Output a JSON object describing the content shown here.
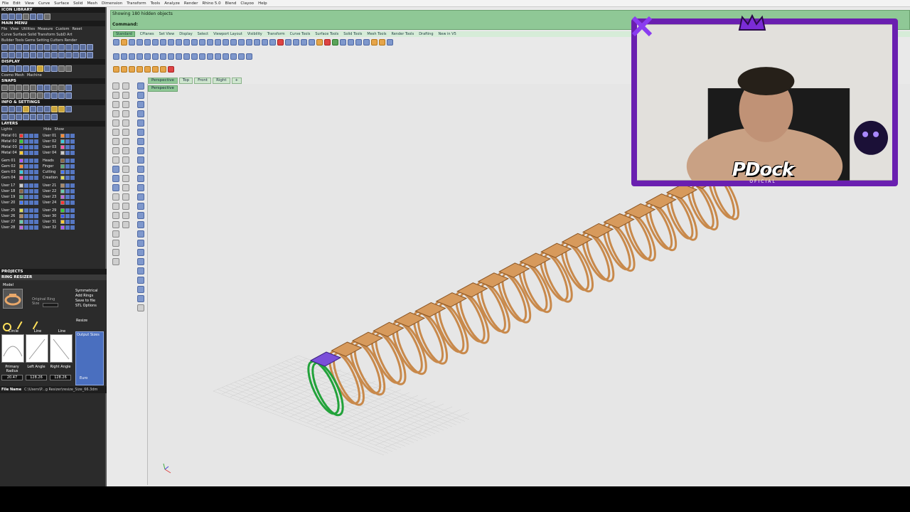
{
  "menu": [
    "File",
    "Edit",
    "View",
    "Curve",
    "Surface",
    "Solid",
    "Mesh",
    "Dimension",
    "Transform",
    "Tools",
    "Analyze",
    "Render",
    "Rhino 5.0",
    "Blend",
    "Clayoo",
    "Help"
  ],
  "left_panel": {
    "section_icon_library": "ICON LIBRARY",
    "section_main_menu": "MAIN MENU",
    "main_menu_items": [
      "File",
      "View",
      "Utilities",
      "Measure",
      "Custom",
      "Reset"
    ],
    "main_menu_sub1": "Curve  Surface  Solid  Transform  SubD  Art",
    "main_menu_sub2": "Builder  Tools  Gems  Setting  Cutters  Render",
    "section_display": "DISPLAY",
    "display_modes": [
      "Cosmo Mesh",
      "Machine"
    ],
    "section_snaps": "SNAPS",
    "section_info": "INFO & SETTINGS",
    "section_layers": "LAYERS",
    "layers_header": [
      "Lights",
      "Hide",
      "Show"
    ],
    "layers_left": [
      "Metal 01",
      "Metal 02",
      "Metal 03",
      "Metal 04",
      "Gem 01",
      "Gem 02",
      "Gem 03",
      "Gem 04",
      "User 17",
      "User 18",
      "User 19",
      "User 20",
      "User 25",
      "User 26",
      "User 27",
      "User 28"
    ],
    "layers_right": [
      "User 01",
      "User 02",
      "User 03",
      "User 04",
      "Heads",
      "Finger",
      "Cutting",
      "Creation",
      "User 21",
      "User 22",
      "User 23",
      "User 24",
      "User 29",
      "User 30",
      "User 31",
      "User 32"
    ],
    "section_projects": "PROJECTS",
    "section_ring_resizer": "RING RESIZER",
    "resizer_model": "Model",
    "resizer_original": "Original Ring Size",
    "resizer_options": [
      "Symmetrical",
      "Add Rings",
      "Save to file",
      "STL Options"
    ],
    "resizer_resize": "Resize",
    "resizer_shapes": [
      "Circle",
      "Line",
      "Line"
    ],
    "resizer_output": "Output Sizes",
    "resizer_primary_label": "Primary Radius",
    "resizer_left_label": "Left Angle",
    "resizer_right_label": "Right Angle",
    "resizer_primary_val": "20.47",
    "resizer_left_val": "128.26",
    "resizer_right_val": "128.26",
    "resizer_unit": "Euro",
    "file_name_label": "File Name",
    "file_name_value": "C:\\Users\\P...g Resizer\\resize_Size_66.3dm"
  },
  "command": {
    "line1": "Showing 180 hidden objects",
    "line2": "Command:"
  },
  "tabs": [
    "Standard",
    "CPlanes",
    "Set View",
    "Display",
    "Select",
    "Viewport Layout",
    "Visibility",
    "Transform",
    "Curve Tools",
    "Surface Tools",
    "Solid Tools",
    "Mesh Tools",
    "Render Tools",
    "Drafting",
    "New in V5"
  ],
  "viewport": {
    "tabs": [
      "Perspective",
      "Top",
      "Front",
      "Right"
    ],
    "add_tab": "+",
    "label": "Perspective"
  },
  "overlay": {
    "name": "PDock",
    "subtitle": "OFICIAL"
  },
  "colors": {
    "gold": "#c8894b",
    "green": "#22a23a",
    "purple": "#6a1fb0",
    "gem": "#7b4fd9"
  }
}
